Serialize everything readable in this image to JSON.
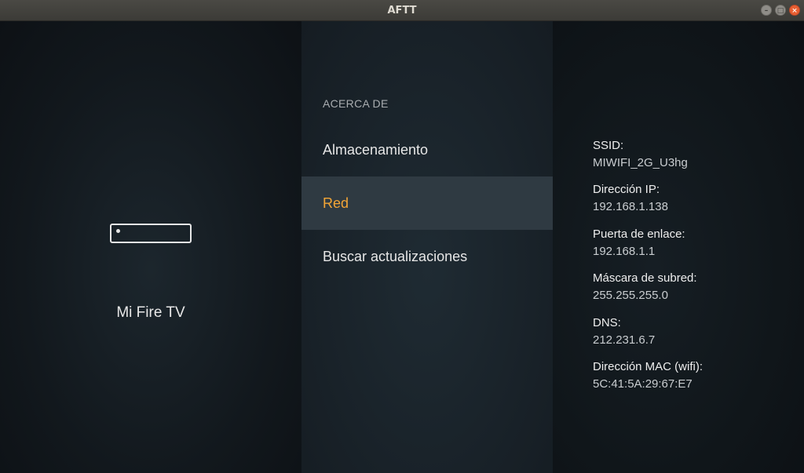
{
  "window": {
    "title": "AFTT",
    "buttons": {
      "minimize": "–",
      "maximize": "□",
      "close": "×"
    }
  },
  "left": {
    "device_icon": "fire-tv-device-icon",
    "device_name": "Mi Fire TV"
  },
  "menu": {
    "header": "ACERCA DE",
    "items": [
      {
        "label": "Almacenamiento",
        "selected": false
      },
      {
        "label": "Red",
        "selected": true
      },
      {
        "label": "Buscar actualizaciones",
        "selected": false
      }
    ]
  },
  "network": {
    "fields": [
      {
        "label": "SSID:",
        "value": "MIWIFI_2G_U3hg"
      },
      {
        "label": "Dirección IP:",
        "value": "192.168.1.138"
      },
      {
        "label": "Puerta de enlace:",
        "value": "192.168.1.1"
      },
      {
        "label": "Máscara de subred:",
        "value": "255.255.255.0"
      },
      {
        "label": "DNS:",
        "value": "212.231.6.7"
      },
      {
        "label": "Dirección MAC (wifi):",
        "value": "5C:41:5A:29:67:E7"
      }
    ]
  },
  "colors": {
    "accent": "#f3a536",
    "selected_bg": "#2f3a42"
  }
}
